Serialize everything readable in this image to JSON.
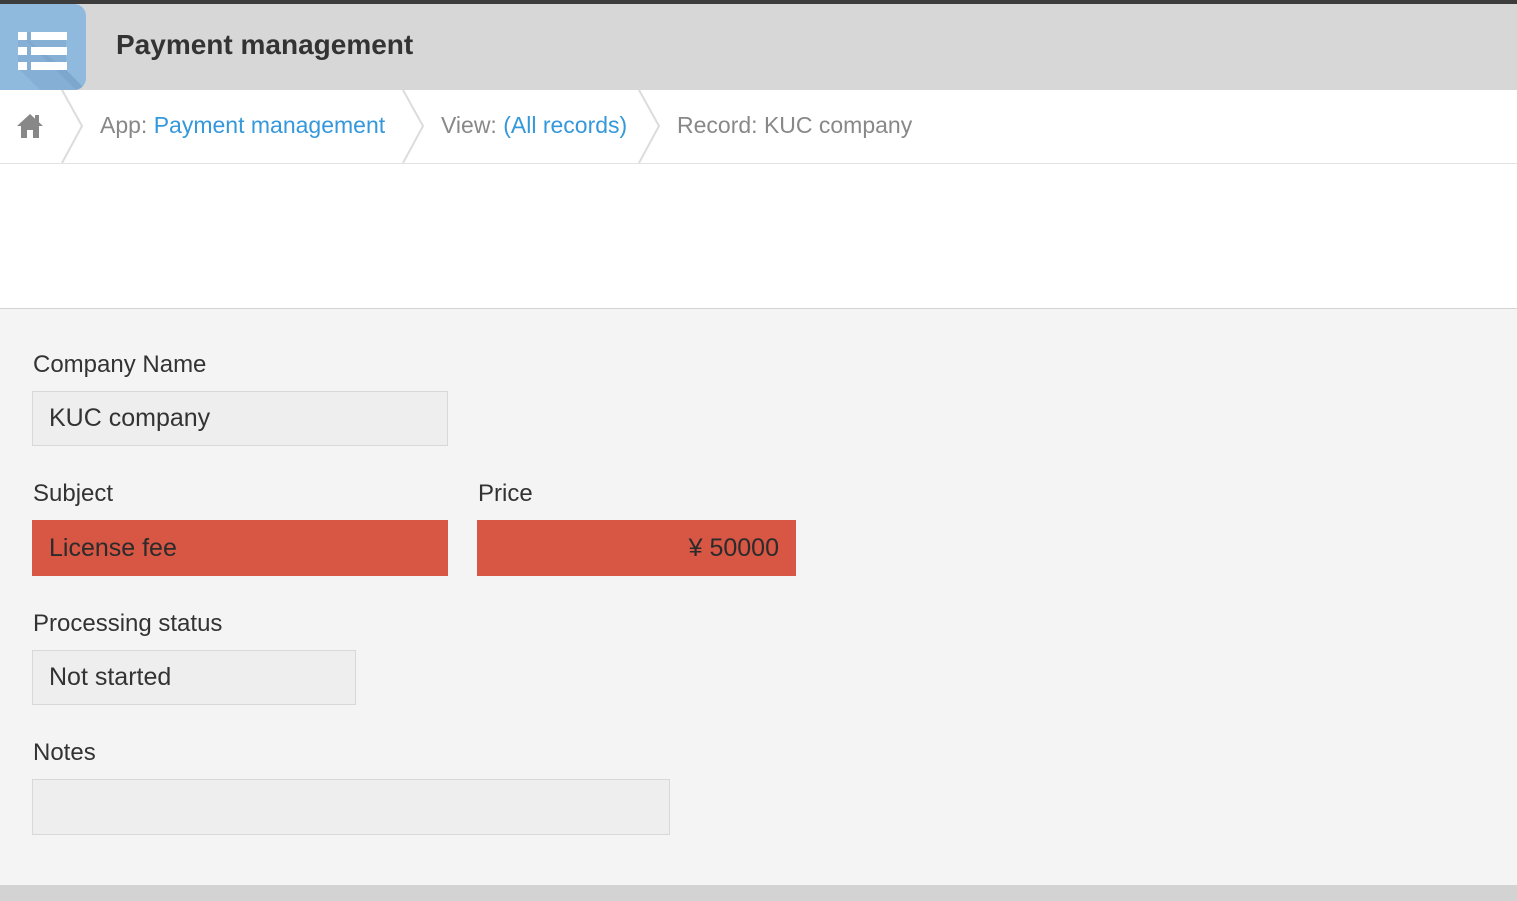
{
  "header": {
    "app_title": "Payment management",
    "app_icon": "list-icon"
  },
  "breadcrumb": {
    "home_icon": "home-icon",
    "app_prefix": "App: ",
    "app_name": "Payment management",
    "view_prefix": "View: ",
    "view_name": "(All records)",
    "record_prefix": "Record: ",
    "record_name": "KUC company"
  },
  "form": {
    "company_name": {
      "label": "Company Name",
      "value": "KUC company"
    },
    "subject": {
      "label": "Subject",
      "value": "License fee"
    },
    "price": {
      "label": "Price",
      "value": "¥ 50000"
    },
    "processing_status": {
      "label": "Processing status",
      "value": "Not started"
    },
    "notes": {
      "label": "Notes",
      "value": ""
    }
  },
  "colors": {
    "header_bg": "#d6d7d6",
    "icon_bg": "#8fb9dd",
    "link": "#3498db",
    "error_field": "#d75644",
    "form_bg": "#f4f4f4"
  }
}
